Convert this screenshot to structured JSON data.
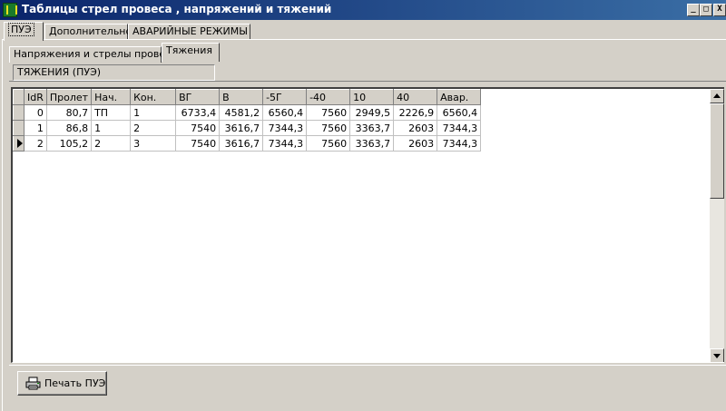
{
  "window": {
    "title": "Таблицы стрел провеса , напряжений и тяжений",
    "controls": {
      "minimize": "_",
      "maximize": "□",
      "close": "X"
    }
  },
  "top_tabs": [
    {
      "label": "ПУЭ",
      "active": true
    },
    {
      "label": "Дополнительно",
      "active": false
    },
    {
      "label": "АВАРИЙНЫЕ РЕЖИМЫ",
      "active": false
    }
  ],
  "sub_tabs": [
    {
      "label": "Напряжения и стрелы провеса",
      "active": false
    },
    {
      "label": "Тяжения",
      "active": true
    }
  ],
  "section_title": "ТЯЖЕНИЯ (ПУЭ)",
  "grid": {
    "columns": [
      "IdR",
      "Пролет",
      "Нач.",
      "Кон.",
      "ВГ",
      "В",
      "-5Г",
      "-40",
      "10",
      "40",
      "Авар."
    ],
    "rows": [
      [
        "0",
        "80,7",
        "ТП",
        "1",
        "6733,4",
        "4581,2",
        "6560,4",
        "7560",
        "2949,5",
        "2226,9",
        "6560,4"
      ],
      [
        "1",
        "86,8",
        "1",
        "2",
        "7540",
        "3616,7",
        "7344,3",
        "7560",
        "3363,7",
        "2603",
        "7344,3"
      ],
      [
        "2",
        "105,2",
        "2",
        "3",
        "7540",
        "3616,7",
        "7344,3",
        "7560",
        "3363,7",
        "2603",
        "7344,3"
      ]
    ],
    "current_row": 2
  },
  "print_button": {
    "label": "Печать ПУЭ",
    "icon": "printer-icon"
  }
}
